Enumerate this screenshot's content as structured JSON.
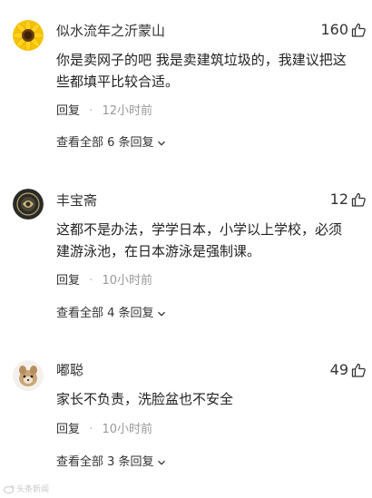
{
  "comments": [
    {
      "username": "似水流年之沂蒙山",
      "likes": "160",
      "avatar_icon": "sunflower-avatar",
      "lines": [
        "你是卖网子的吧 我是卖建筑垃圾的，我建议把这",
        "些都填平比较合适。"
      ],
      "reply_label": "回复",
      "separator": "·",
      "time": "12小时前",
      "view_all": "查看全部 6 条回复"
    },
    {
      "username": "丰宝斋",
      "likes": "12",
      "avatar_icon": "dark-emblem-avatar",
      "lines": [
        "这都不是办法，学学日本，小学以上学校，必须",
        "建游泳池，在日本游泳是强制课。"
      ],
      "reply_label": "回复",
      "separator": "·",
      "time": "10小时前",
      "view_all": "查看全部 4 条回复"
    },
    {
      "username": "嘟聪",
      "likes": "49",
      "avatar_icon": "animal-avatar",
      "lines": [
        "家长不负责，洗脸盆也不安全"
      ],
      "reply_label": "回复",
      "separator": "·",
      "time": "10小时前",
      "view_all": "查看全部 3 条回复"
    }
  ],
  "watermark": {
    "text": "头条新闻",
    "icon": "weibo-icon"
  },
  "colors": {
    "text": "#222222",
    "muted": "#9a9a9a",
    "icon": "#333333"
  }
}
